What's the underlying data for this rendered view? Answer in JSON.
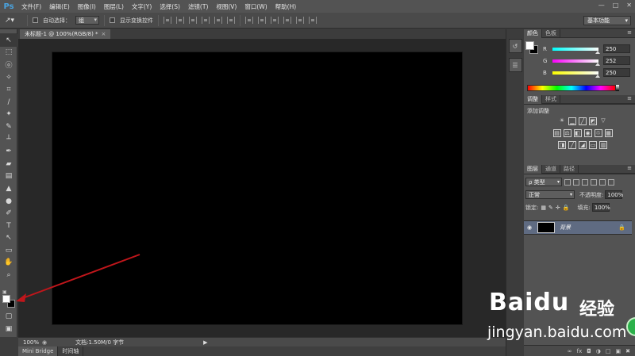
{
  "app": {
    "logo": "Ps"
  },
  "menu": [
    "文件(F)",
    "编辑(E)",
    "图像(I)",
    "图层(L)",
    "文字(Y)",
    "选择(S)",
    "滤镜(T)",
    "视图(V)",
    "窗口(W)",
    "帮助(H)"
  ],
  "window_controls": [
    "—",
    "□",
    "✕"
  ],
  "options": {
    "auto_select_label": "自动选择：",
    "auto_select_value": "组",
    "show_transform_label": "显示变换控件",
    "workspace": "基本功能"
  },
  "document": {
    "tab_title": "未标题-1 @ 100%(RGB/8) *",
    "canvas_color": "#000000"
  },
  "status": {
    "zoom": "100%",
    "doc_info": "文档:1.50M/0 字节"
  },
  "bottom_tabs": [
    "Mini Bridge",
    "时间轴"
  ],
  "color_panel": {
    "tabs": [
      "颜色",
      "色板"
    ],
    "foreground": "#ffffff",
    "background": "#000000",
    "channels": [
      {
        "label": "R",
        "value": "250",
        "level": 0.98
      },
      {
        "label": "G",
        "value": "252",
        "level": 0.99
      },
      {
        "label": "B",
        "value": "250",
        "level": 0.98
      }
    ]
  },
  "adjust_panel": {
    "tabs": [
      "调整",
      "样式"
    ],
    "title": "添加调整"
  },
  "layers_panel": {
    "tabs": [
      "图层",
      "通道",
      "路径"
    ],
    "filter_label": "ρ 类型",
    "blend_mode": "正常",
    "opacity_label": "不透明度:",
    "opacity_value": "100%",
    "lock_label": "锁定:",
    "fill_label": "填充:",
    "fill_value": "100%",
    "layer_name": "背景"
  },
  "watermark": {
    "brand": "Baidu",
    "brand_cn": "经验",
    "url": "jingyan.baidu.com"
  },
  "annotation_color": "#c0161b"
}
